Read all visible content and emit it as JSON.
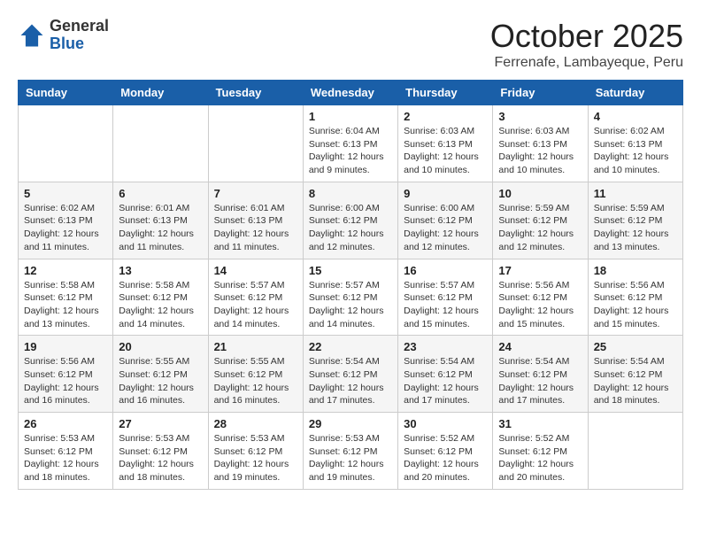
{
  "header": {
    "logo": {
      "line1": "General",
      "line2": "Blue"
    },
    "title": "October 2025",
    "location": "Ferrenafe, Lambayeque, Peru"
  },
  "weekdays": [
    "Sunday",
    "Monday",
    "Tuesday",
    "Wednesday",
    "Thursday",
    "Friday",
    "Saturday"
  ],
  "weeks": [
    [
      {
        "day": "",
        "info": ""
      },
      {
        "day": "",
        "info": ""
      },
      {
        "day": "",
        "info": ""
      },
      {
        "day": "1",
        "info": "Sunrise: 6:04 AM\nSunset: 6:13 PM\nDaylight: 12 hours\nand 9 minutes."
      },
      {
        "day": "2",
        "info": "Sunrise: 6:03 AM\nSunset: 6:13 PM\nDaylight: 12 hours\nand 10 minutes."
      },
      {
        "day": "3",
        "info": "Sunrise: 6:03 AM\nSunset: 6:13 PM\nDaylight: 12 hours\nand 10 minutes."
      },
      {
        "day": "4",
        "info": "Sunrise: 6:02 AM\nSunset: 6:13 PM\nDaylight: 12 hours\nand 10 minutes."
      }
    ],
    [
      {
        "day": "5",
        "info": "Sunrise: 6:02 AM\nSunset: 6:13 PM\nDaylight: 12 hours\nand 11 minutes."
      },
      {
        "day": "6",
        "info": "Sunrise: 6:01 AM\nSunset: 6:13 PM\nDaylight: 12 hours\nand 11 minutes."
      },
      {
        "day": "7",
        "info": "Sunrise: 6:01 AM\nSunset: 6:13 PM\nDaylight: 12 hours\nand 11 minutes."
      },
      {
        "day": "8",
        "info": "Sunrise: 6:00 AM\nSunset: 6:12 PM\nDaylight: 12 hours\nand 12 minutes."
      },
      {
        "day": "9",
        "info": "Sunrise: 6:00 AM\nSunset: 6:12 PM\nDaylight: 12 hours\nand 12 minutes."
      },
      {
        "day": "10",
        "info": "Sunrise: 5:59 AM\nSunset: 6:12 PM\nDaylight: 12 hours\nand 12 minutes."
      },
      {
        "day": "11",
        "info": "Sunrise: 5:59 AM\nSunset: 6:12 PM\nDaylight: 12 hours\nand 13 minutes."
      }
    ],
    [
      {
        "day": "12",
        "info": "Sunrise: 5:58 AM\nSunset: 6:12 PM\nDaylight: 12 hours\nand 13 minutes."
      },
      {
        "day": "13",
        "info": "Sunrise: 5:58 AM\nSunset: 6:12 PM\nDaylight: 12 hours\nand 14 minutes."
      },
      {
        "day": "14",
        "info": "Sunrise: 5:57 AM\nSunset: 6:12 PM\nDaylight: 12 hours\nand 14 minutes."
      },
      {
        "day": "15",
        "info": "Sunrise: 5:57 AM\nSunset: 6:12 PM\nDaylight: 12 hours\nand 14 minutes."
      },
      {
        "day": "16",
        "info": "Sunrise: 5:57 AM\nSunset: 6:12 PM\nDaylight: 12 hours\nand 15 minutes."
      },
      {
        "day": "17",
        "info": "Sunrise: 5:56 AM\nSunset: 6:12 PM\nDaylight: 12 hours\nand 15 minutes."
      },
      {
        "day": "18",
        "info": "Sunrise: 5:56 AM\nSunset: 6:12 PM\nDaylight: 12 hours\nand 15 minutes."
      }
    ],
    [
      {
        "day": "19",
        "info": "Sunrise: 5:56 AM\nSunset: 6:12 PM\nDaylight: 12 hours\nand 16 minutes."
      },
      {
        "day": "20",
        "info": "Sunrise: 5:55 AM\nSunset: 6:12 PM\nDaylight: 12 hours\nand 16 minutes."
      },
      {
        "day": "21",
        "info": "Sunrise: 5:55 AM\nSunset: 6:12 PM\nDaylight: 12 hours\nand 16 minutes."
      },
      {
        "day": "22",
        "info": "Sunrise: 5:54 AM\nSunset: 6:12 PM\nDaylight: 12 hours\nand 17 minutes."
      },
      {
        "day": "23",
        "info": "Sunrise: 5:54 AM\nSunset: 6:12 PM\nDaylight: 12 hours\nand 17 minutes."
      },
      {
        "day": "24",
        "info": "Sunrise: 5:54 AM\nSunset: 6:12 PM\nDaylight: 12 hours\nand 17 minutes."
      },
      {
        "day": "25",
        "info": "Sunrise: 5:54 AM\nSunset: 6:12 PM\nDaylight: 12 hours\nand 18 minutes."
      }
    ],
    [
      {
        "day": "26",
        "info": "Sunrise: 5:53 AM\nSunset: 6:12 PM\nDaylight: 12 hours\nand 18 minutes."
      },
      {
        "day": "27",
        "info": "Sunrise: 5:53 AM\nSunset: 6:12 PM\nDaylight: 12 hours\nand 18 minutes."
      },
      {
        "day": "28",
        "info": "Sunrise: 5:53 AM\nSunset: 6:12 PM\nDaylight: 12 hours\nand 19 minutes."
      },
      {
        "day": "29",
        "info": "Sunrise: 5:53 AM\nSunset: 6:12 PM\nDaylight: 12 hours\nand 19 minutes."
      },
      {
        "day": "30",
        "info": "Sunrise: 5:52 AM\nSunset: 6:12 PM\nDaylight: 12 hours\nand 20 minutes."
      },
      {
        "day": "31",
        "info": "Sunrise: 5:52 AM\nSunset: 6:12 PM\nDaylight: 12 hours\nand 20 minutes."
      },
      {
        "day": "",
        "info": ""
      }
    ]
  ]
}
